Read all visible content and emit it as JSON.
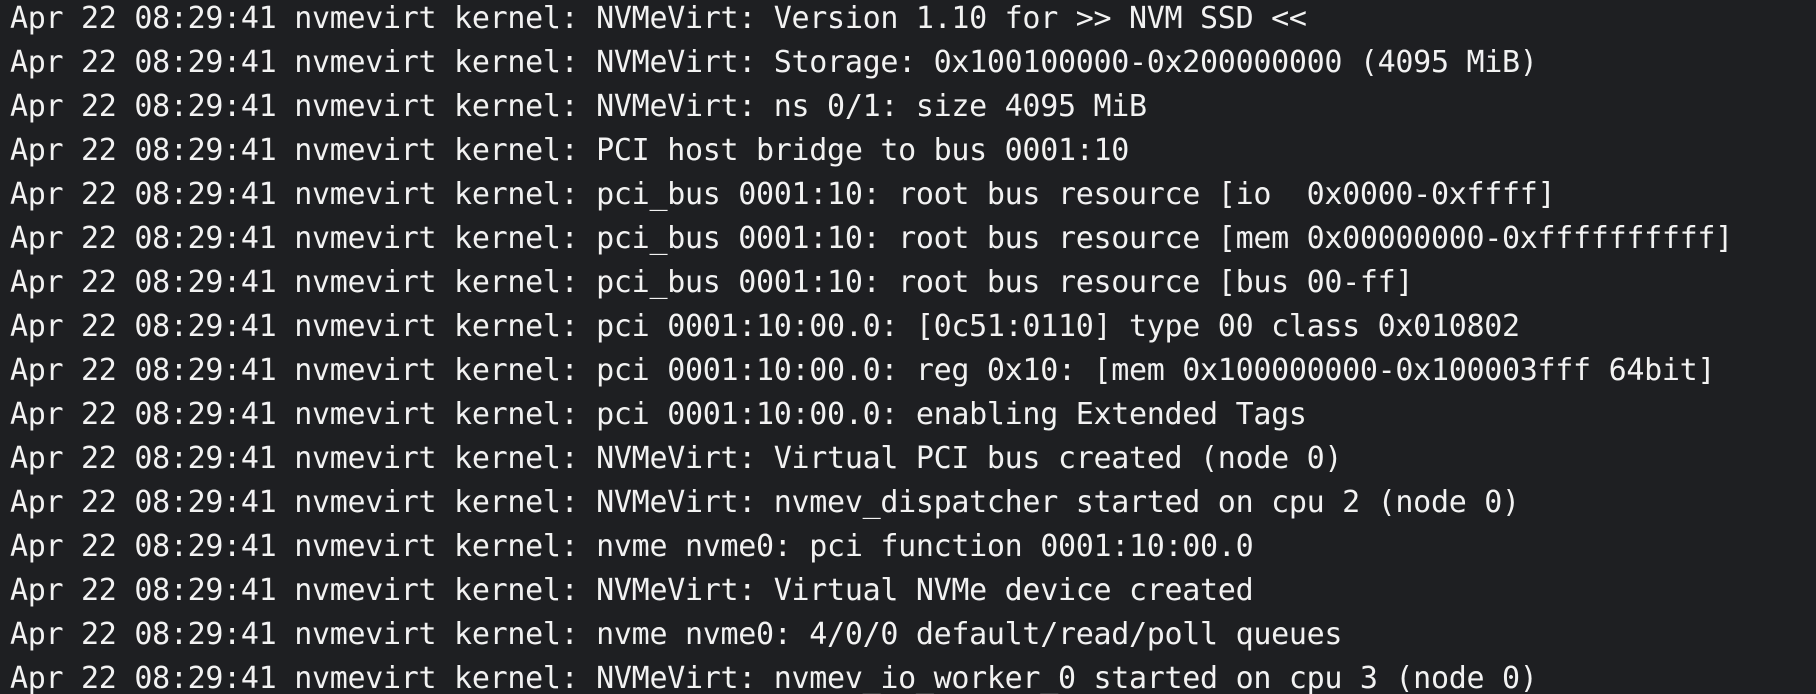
{
  "lines": [
    {
      "ts": "Apr 22 08:29:41",
      "src": "nvmevirt kernel:",
      "msg": "NVMeVirt: Version 1.10 for >> NVM SSD <<"
    },
    {
      "ts": "Apr 22 08:29:41",
      "src": "nvmevirt kernel:",
      "msg": "NVMeVirt: Storage: 0x100100000-0x200000000 (4095 MiB)"
    },
    {
      "ts": "Apr 22 08:29:41",
      "src": "nvmevirt kernel:",
      "msg": "NVMeVirt: ns 0/1: size 4095 MiB"
    },
    {
      "ts": "Apr 22 08:29:41",
      "src": "nvmevirt kernel:",
      "msg": "PCI host bridge to bus 0001:10"
    },
    {
      "ts": "Apr 22 08:29:41",
      "src": "nvmevirt kernel:",
      "msg": "pci_bus 0001:10: root bus resource [io  0x0000-0xffff]"
    },
    {
      "ts": "Apr 22 08:29:41",
      "src": "nvmevirt kernel:",
      "msg": "pci_bus 0001:10: root bus resource [mem 0x00000000-0xffffffffff]"
    },
    {
      "ts": "Apr 22 08:29:41",
      "src": "nvmevirt kernel:",
      "msg": "pci_bus 0001:10: root bus resource [bus 00-ff]"
    },
    {
      "ts": "Apr 22 08:29:41",
      "src": "nvmevirt kernel:",
      "msg": "pci 0001:10:00.0: [0c51:0110] type 00 class 0x010802"
    },
    {
      "ts": "Apr 22 08:29:41",
      "src": "nvmevirt kernel:",
      "msg": "pci 0001:10:00.0: reg 0x10: [mem 0x100000000-0x100003fff 64bit]"
    },
    {
      "ts": "Apr 22 08:29:41",
      "src": "nvmevirt kernel:",
      "msg": "pci 0001:10:00.0: enabling Extended Tags"
    },
    {
      "ts": "Apr 22 08:29:41",
      "src": "nvmevirt kernel:",
      "msg": "NVMeVirt: Virtual PCI bus created (node 0)"
    },
    {
      "ts": "Apr 22 08:29:41",
      "src": "nvmevirt kernel:",
      "msg": "NVMeVirt: nvmev_dispatcher started on cpu 2 (node 0)"
    },
    {
      "ts": "Apr 22 08:29:41",
      "src": "nvmevirt kernel:",
      "msg": "nvme nvme0: pci function 0001:10:00.0"
    },
    {
      "ts": "Apr 22 08:29:41",
      "src": "nvmevirt kernel:",
      "msg": "NVMeVirt: Virtual NVMe device created"
    },
    {
      "ts": "Apr 22 08:29:41",
      "src": "nvmevirt kernel:",
      "msg": "nvme nvme0: 4/0/0 default/read/poll queues"
    },
    {
      "ts": "Apr 22 08:29:41",
      "src": "nvmevirt kernel:",
      "msg": "NVMeVirt: nvmev_io_worker_0 started on cpu 3 (node 0)"
    }
  ]
}
